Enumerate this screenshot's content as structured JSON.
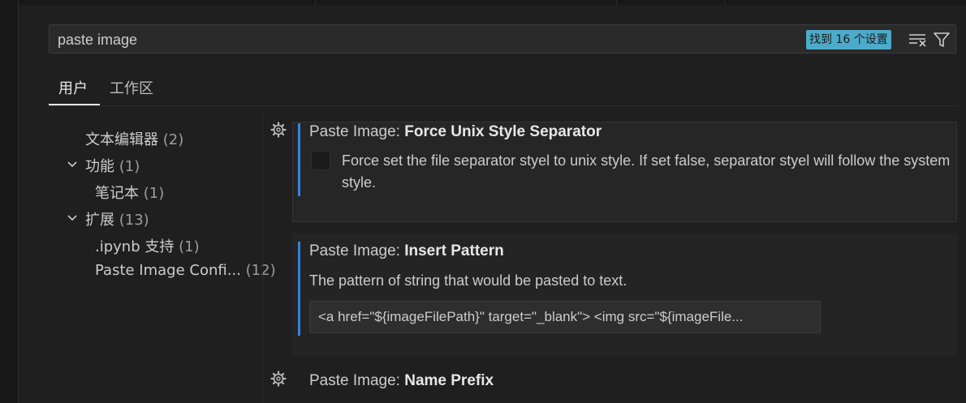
{
  "search": {
    "value": "paste image",
    "result_badge": "找到 16 个设置"
  },
  "tabs": [
    {
      "label": "用户"
    },
    {
      "label": "工作区"
    }
  ],
  "toc": [
    {
      "label": "文本编辑器",
      "count": "(2)"
    },
    {
      "label": "功能",
      "count": "(1)"
    },
    {
      "label": "笔记本",
      "count": "(1)"
    },
    {
      "label": "扩展",
      "count": "(13)"
    },
    {
      "label": ".ipynb 支持",
      "count": "(1)"
    },
    {
      "label": "Paste Image Confi...",
      "count": "(12)"
    }
  ],
  "settings": [
    {
      "category": "Paste Image: ",
      "name": "Force Unix Style Separator",
      "description": "Force set the file separator styel to unix style. If set false, separator styel will follow the system style.",
      "checked": false
    },
    {
      "category": "Paste Image: ",
      "name": "Insert Pattern",
      "description": "The pattern of string that would be pasted to text.",
      "value": "<a href=\"${imageFilePath}\" target=\"_blank\"> <img src=\"${imageFile..."
    },
    {
      "category": "Paste Image: ",
      "name": "Name Prefix"
    }
  ],
  "colors": {
    "background": "#1f1f1f",
    "badge": "#4daac9",
    "accent": "#3794ff"
  }
}
